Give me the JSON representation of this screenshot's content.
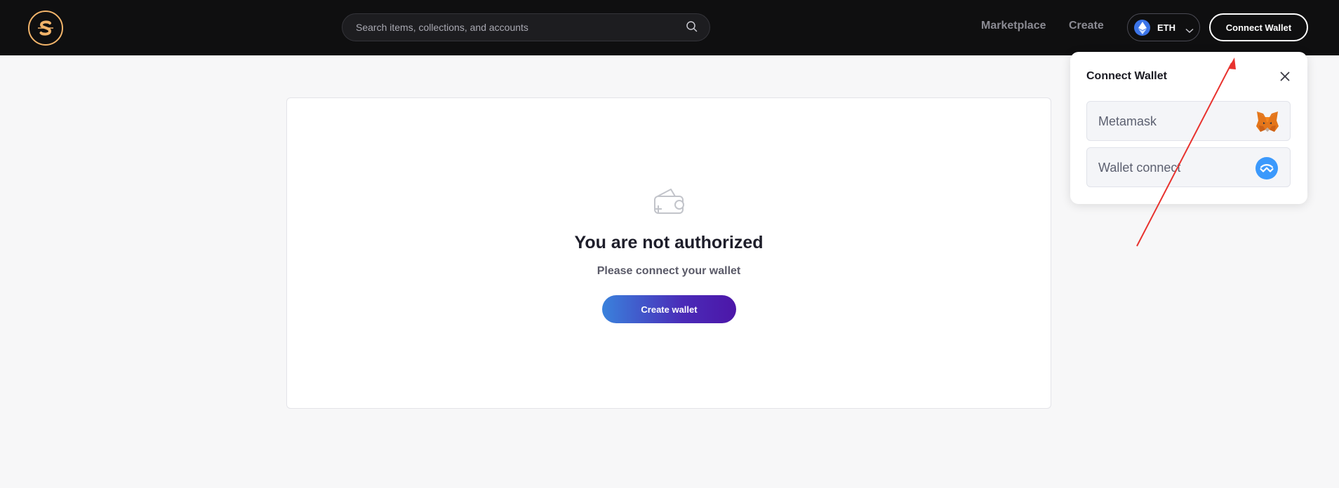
{
  "header": {
    "logo_icon": "s-coin-logo-icon",
    "search": {
      "placeholder": "Search items, collections, and accounts"
    },
    "nav": [
      {
        "label": "Marketplace"
      },
      {
        "label": "Create"
      }
    ],
    "network": {
      "label": "ETH",
      "icon": "ethereum-icon"
    },
    "connect_label": "Connect Wallet"
  },
  "main": {
    "icon": "wallet-add-icon",
    "title": "You are not authorized",
    "subtitle": "Please connect your wallet",
    "create_label": "Create wallet"
  },
  "popup": {
    "title": "Connect Wallet",
    "options": [
      {
        "label": "Metamask",
        "icon": "metamask-fox-icon"
      },
      {
        "label": "Wallet connect",
        "icon": "walletconnect-icon"
      }
    ]
  },
  "colors": {
    "header_bg": "#0f0f10",
    "logo_accent": "#f2b46a",
    "button_gradient_start": "#3a82dc",
    "button_gradient_end": "#4c16a8",
    "annotation_arrow": "#e8322e"
  }
}
